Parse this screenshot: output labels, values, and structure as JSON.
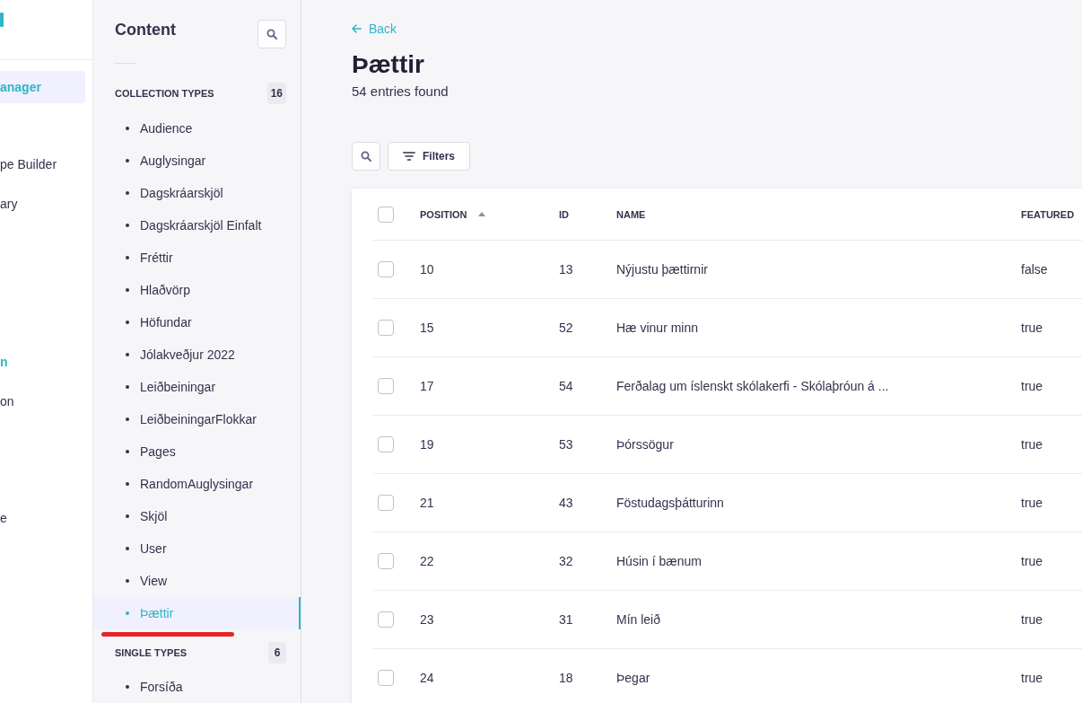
{
  "main_nav": {
    "sections": [
      {
        "items": [
          {
            "label": "anager",
            "kind": "link",
            "selected": true
          }
        ]
      },
      {
        "items": [
          {
            "label": "pe Builder",
            "kind": "link",
            "selected": false
          },
          {
            "label": "ary",
            "kind": "link",
            "selected": false
          }
        ]
      },
      {
        "items": [
          {
            "label": "n",
            "kind": "heading",
            "selected": false
          },
          {
            "label": "on",
            "kind": "link",
            "selected": false
          }
        ]
      },
      {
        "items": [
          {
            "label": "e",
            "kind": "link",
            "selected": false
          }
        ]
      }
    ]
  },
  "sidebar": {
    "title": "Content",
    "groups": [
      {
        "heading": "COLLECTION TYPES",
        "count": "16",
        "items": [
          {
            "label": "Audience",
            "selected": false
          },
          {
            "label": "Auglysingar",
            "selected": false
          },
          {
            "label": "Dagskráarskjöl",
            "selected": false
          },
          {
            "label": "Dagskráarskjöl Einfalt",
            "selected": false
          },
          {
            "label": "Fréttir",
            "selected": false
          },
          {
            "label": "Hlaðvörp",
            "selected": false
          },
          {
            "label": "Höfundar",
            "selected": false
          },
          {
            "label": "Jólakveðjur 2022",
            "selected": false
          },
          {
            "label": "Leiðbeiningar",
            "selected": false
          },
          {
            "label": "LeiðbeiningarFlokkar",
            "selected": false
          },
          {
            "label": "Pages",
            "selected": false
          },
          {
            "label": "RandomAuglysingar",
            "selected": false
          },
          {
            "label": "Skjöl",
            "selected": false
          },
          {
            "label": "User",
            "selected": false
          },
          {
            "label": "View",
            "selected": false
          },
          {
            "label": "Þættir",
            "selected": true
          }
        ]
      },
      {
        "heading": "SINGLE TYPES",
        "count": "6",
        "items": [
          {
            "label": "Forsíða",
            "selected": false
          }
        ]
      }
    ],
    "annotation": {
      "kind": "underline"
    }
  },
  "page": {
    "back_link": "Back",
    "title": "Þættir",
    "subtitle": "54 entries found",
    "filters_button": "Filters"
  },
  "table": {
    "select_all_checked": false,
    "columns": [
      {
        "label": "POSITION",
        "sorted": true
      },
      {
        "label": "ID",
        "sorted": false
      },
      {
        "label": "NAME",
        "sorted": false
      },
      {
        "label": "FEATURED",
        "sorted": false
      }
    ],
    "rows": [
      {
        "checked": false,
        "cells": [
          "10",
          "13",
          "Nýjustu þættirnir",
          "false"
        ]
      },
      {
        "checked": false,
        "cells": [
          "15",
          "52",
          "Hæ vinur minn",
          "true"
        ]
      },
      {
        "checked": false,
        "cells": [
          "17",
          "54",
          "Ferðalag um íslenskt skólakerfi - Skólaþróun á ...",
          "true"
        ]
      },
      {
        "checked": false,
        "cells": [
          "19",
          "53",
          "Þórssögur",
          "true"
        ]
      },
      {
        "checked": false,
        "cells": [
          "21",
          "43",
          "Föstudagsþátturinn",
          "true"
        ]
      },
      {
        "checked": false,
        "cells": [
          "22",
          "32",
          "Húsin í bænum",
          "true"
        ]
      },
      {
        "checked": false,
        "cells": [
          "23",
          "31",
          "Mín leið",
          "true"
        ]
      },
      {
        "checked": false,
        "cells": [
          "24",
          "18",
          "Þegar",
          "true"
        ]
      }
    ]
  }
}
